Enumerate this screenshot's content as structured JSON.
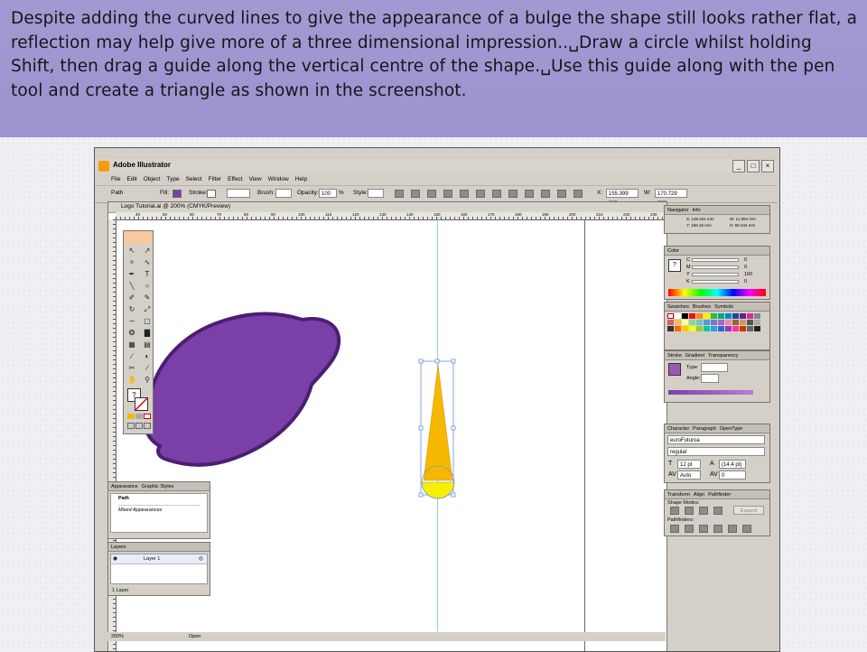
{
  "slide": {
    "text": "Despite adding the curved lines to give the appearance of a bulge the shape still looks rather flat, a reflection may help give more of a three dimensional impression..␣Draw a circle whilst holding Shift, then drag a guide along the vertical centre of the shape.␣Use this guide along with the pen tool and create a triangle as shown in the screenshot."
  },
  "app": {
    "title": "Adobe Illustrator",
    "window_buttons": [
      "_",
      "□",
      "×"
    ],
    "menu": [
      "File",
      "Edit",
      "Object",
      "Type",
      "Select",
      "Filter",
      "Effect",
      "View",
      "Window",
      "Help"
    ]
  },
  "control_bar": {
    "object_type": "Path",
    "fill_label": "Fill:",
    "stroke_label": "Stroke:",
    "brush_label": "Brush:",
    "opacity_label": "Opacity:",
    "opacity_value": "100",
    "opacity_unit": "%",
    "style_label": "Style:",
    "x_label": "X:",
    "x_value": "155.399 mm",
    "w_label": "W:",
    "w_value": "170.729 mm"
  },
  "document": {
    "title": "Logo Tutorial.ai @ 200% (CMYK/Preview)",
    "ruler_ticks": [
      "40",
      "50",
      "60",
      "70",
      "80",
      "90",
      "100",
      "110",
      "120",
      "130",
      "140",
      "150",
      "160",
      "170",
      "180",
      "190",
      "200",
      "210",
      "220",
      "230"
    ],
    "zoom": "200%",
    "status": "Open"
  },
  "info_panel": {
    "tabs": [
      "Navigator",
      "Info"
    ],
    "x": "X: 149.401 mm",
    "y": "Y: 156.15 mm",
    "w": "W: 11.994 mm",
    "h": "H: 50.344 mm"
  },
  "color_panel": {
    "tab": "Color",
    "channels": [
      {
        "label": "C",
        "value": "0"
      },
      {
        "label": "M",
        "value": "0"
      },
      {
        "label": "Y",
        "value": "100"
      },
      {
        "label": "K",
        "value": "0"
      }
    ]
  },
  "swatches_panel": {
    "tabs": [
      "Swatches",
      "Brushes",
      "Symbols"
    ]
  },
  "gradient_panel": {
    "tabs": [
      "Stroke",
      "Gradient",
      "Transparency"
    ],
    "type_label": "Type:",
    "angle_label": "Angle:"
  },
  "character_panel": {
    "tabs": [
      "Character",
      "Paragraph",
      "OpenType"
    ],
    "font": "euroFuturoa",
    "style": "regular",
    "size": "12 pt",
    "leading": "(14.4 pt)",
    "tracking": "Auto",
    "kerning": "0"
  },
  "pathfinder_panel": {
    "tabs": [
      "Transform",
      "Align",
      "Pathfinder"
    ],
    "shape_modes": "Shape Modes:",
    "pathfinders": "Pathfinders:",
    "expand": "Expand"
  },
  "appearance_panel": {
    "tabs": [
      "Appearance",
      "Graphic Styles"
    ],
    "item": "Path",
    "mixed": "Mixed Appearances"
  },
  "layers_panel": {
    "tab": "Layers",
    "layer": "Layer 1",
    "count": "1 Layer"
  },
  "colors": {
    "purple": "#7b3fa8",
    "purple_stroke": "#4a1f73",
    "yellow": "#f6b800",
    "bright_yellow": "#f4f000",
    "guide": "#7fd6e0",
    "selection": "#6a8fd8"
  }
}
